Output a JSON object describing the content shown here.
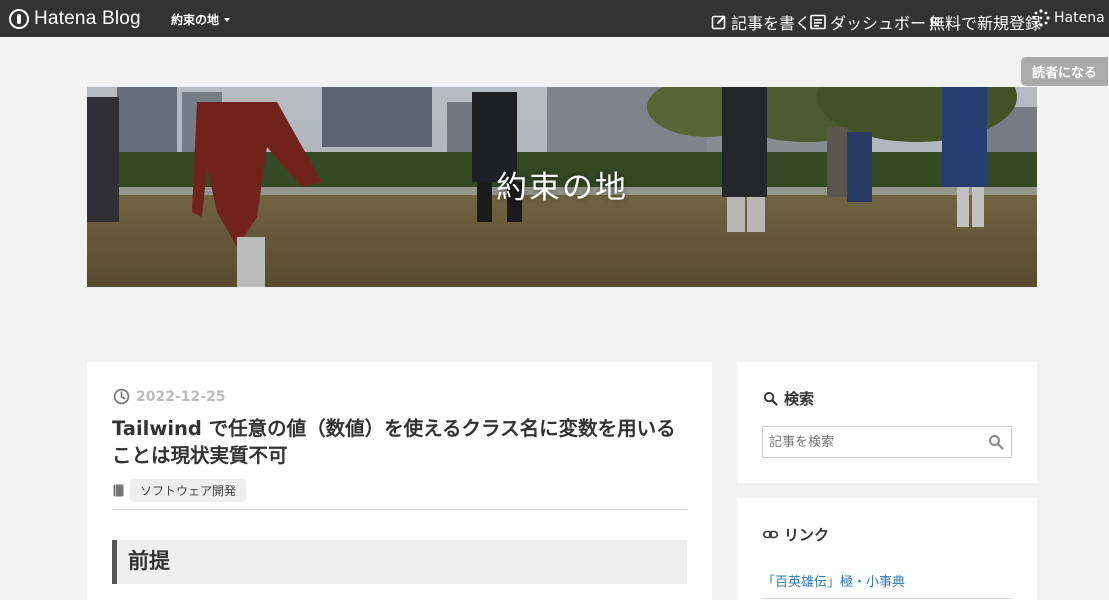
{
  "topbar": {
    "brand": "Hatena Blog",
    "blog_menu": "約束の地",
    "write_label": "記事を書く",
    "dashboard_label": "ダッシュボード",
    "signup_label": "無料で新規登録",
    "hatena_label": "Hatena"
  },
  "subscribe_label": "読者になる",
  "banner": {
    "title": "約束の地"
  },
  "entry": {
    "date": "2022-12-25",
    "title": "Tailwind で任意の値（数値）を使えるクラス名に変数を用いることは現状実質不可",
    "category": "ソフトウェア開発",
    "heading": "前提"
  },
  "sidebar": {
    "search": {
      "title": "検索",
      "placeholder": "記事を検索"
    },
    "links": {
      "title": "リンク",
      "items": [
        "「百英雄伝」極・小事典"
      ]
    }
  },
  "colors": {
    "topbar": "#333333",
    "link": "#2e7bb3",
    "accent_bar": "#555555"
  }
}
